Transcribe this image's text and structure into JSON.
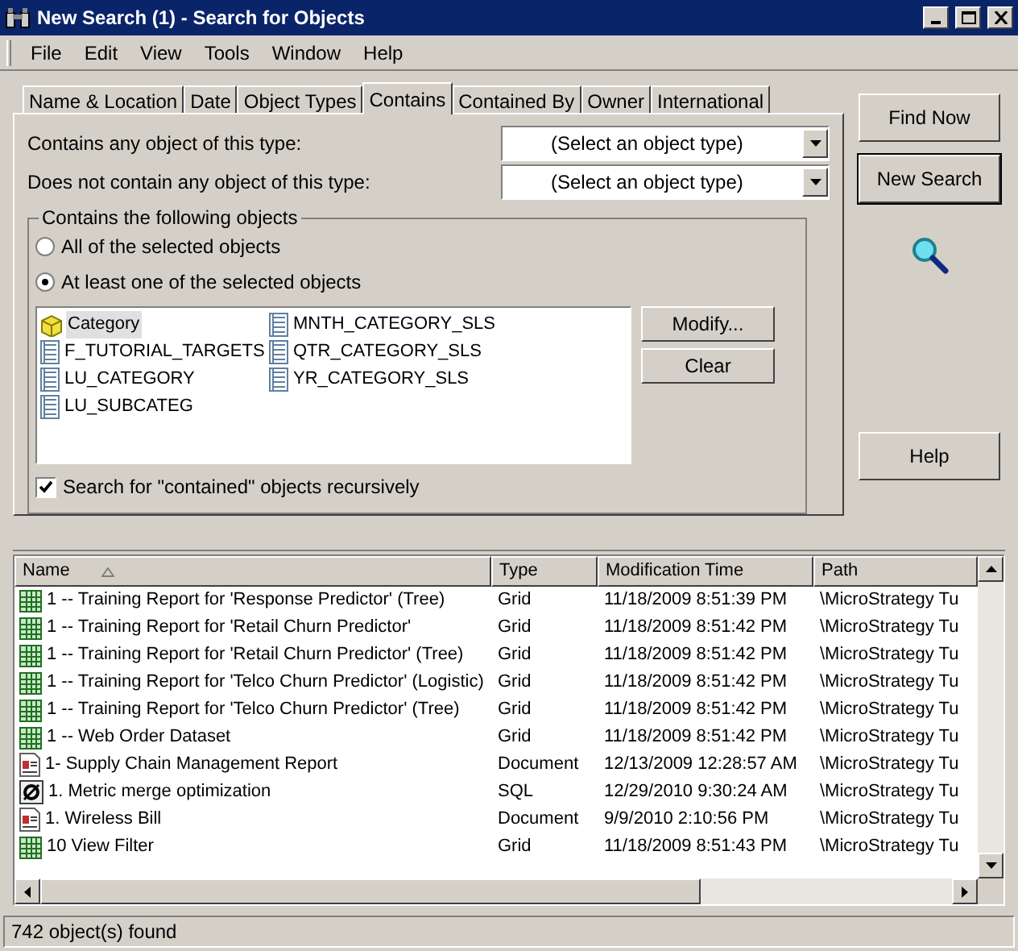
{
  "window": {
    "title": "New Search (1) - Search for Objects"
  },
  "menu": [
    "File",
    "Edit",
    "View",
    "Tools",
    "Window",
    "Help"
  ],
  "tabs": [
    {
      "label": "Name & Location",
      "selected": false
    },
    {
      "label": "Date",
      "selected": false
    },
    {
      "label": "Object Types",
      "selected": false
    },
    {
      "label": "Contains",
      "selected": true
    },
    {
      "label": "Contained By",
      "selected": false
    },
    {
      "label": "Owner",
      "selected": false
    },
    {
      "label": "International",
      "selected": false
    }
  ],
  "contains_any": {
    "label": "Contains any object of this type:",
    "value": "(Select an object type)"
  },
  "not_contain": {
    "label": "Does not contain any object of this type:",
    "value": "(Select an object type)"
  },
  "group": {
    "title": "Contains the following objects",
    "options": [
      {
        "label": "All of the selected objects",
        "selected": false
      },
      {
        "label": "At least one of the selected objects",
        "selected": true
      }
    ],
    "objects": [
      {
        "name": "Category",
        "kind": "attribute",
        "selected": true
      },
      {
        "name": "F_TUTORIAL_TARGETS",
        "kind": "table",
        "selected": false
      },
      {
        "name": "LU_CATEGORY",
        "kind": "table",
        "selected": false
      },
      {
        "name": "LU_SUBCATEG",
        "kind": "table",
        "selected": false
      },
      {
        "name": "MNTH_CATEGORY_SLS",
        "kind": "table",
        "selected": false
      },
      {
        "name": "QTR_CATEGORY_SLS",
        "kind": "table",
        "selected": false
      },
      {
        "name": "YR_CATEGORY_SLS",
        "kind": "table",
        "selected": false
      }
    ],
    "buttons": [
      "Modify...",
      "Clear"
    ],
    "recursive": {
      "label": "Search for \"contained\" objects recursively",
      "checked": true
    }
  },
  "side_buttons": [
    {
      "label": "Find Now",
      "default": false
    },
    {
      "label": "New Search",
      "default": true
    },
    {
      "label": "Help",
      "default": false
    }
  ],
  "table": {
    "columns": [
      "Name",
      "Type",
      "Modification Time",
      "Path"
    ],
    "rows": [
      {
        "kind": "grid",
        "name": "1 -- Training Report for 'Response Predictor' (Tree)",
        "type": "Grid",
        "time": "11/18/2009 8:51:39 PM",
        "path": "\\MicroStrategy Tu"
      },
      {
        "kind": "grid",
        "name": "1 -- Training Report for 'Retail Churn Predictor'",
        "type": "Grid",
        "time": "11/18/2009 8:51:42 PM",
        "path": "\\MicroStrategy Tu"
      },
      {
        "kind": "grid",
        "name": "1 -- Training Report for 'Retail Churn Predictor' (Tree)",
        "type": "Grid",
        "time": "11/18/2009 8:51:42 PM",
        "path": "\\MicroStrategy Tu"
      },
      {
        "kind": "grid",
        "name": "1 -- Training Report for 'Telco Churn Predictor' (Logistic)",
        "type": "Grid",
        "time": "11/18/2009 8:51:42 PM",
        "path": "\\MicroStrategy Tu"
      },
      {
        "kind": "grid",
        "name": "1 -- Training Report for 'Telco Churn Predictor' (Tree)",
        "type": "Grid",
        "time": "11/18/2009 8:51:42 PM",
        "path": "\\MicroStrategy Tu"
      },
      {
        "kind": "grid",
        "name": "1 -- Web Order Dataset",
        "type": "Grid",
        "time": "11/18/2009 8:51:42 PM",
        "path": "\\MicroStrategy Tu"
      },
      {
        "kind": "document",
        "name": "1- Supply Chain Management Report",
        "type": "Document",
        "time": "12/13/2009 12:28:57 AM",
        "path": "\\MicroStrategy Tu"
      },
      {
        "kind": "sql",
        "name": "1. Metric merge optimization",
        "type": "SQL",
        "time": "12/29/2010 9:30:24 AM",
        "path": "\\MicroStrategy Tu"
      },
      {
        "kind": "document",
        "name": "1. Wireless Bill",
        "type": "Document",
        "time": "9/9/2010 2:10:56 PM",
        "path": "\\MicroStrategy Tu"
      },
      {
        "kind": "grid",
        "name": "10 View Filter",
        "type": "Grid",
        "time": "11/18/2009 8:51:43 PM",
        "path": "\\MicroStrategy Tu"
      }
    ]
  },
  "status_bar": "742 object(s) found"
}
